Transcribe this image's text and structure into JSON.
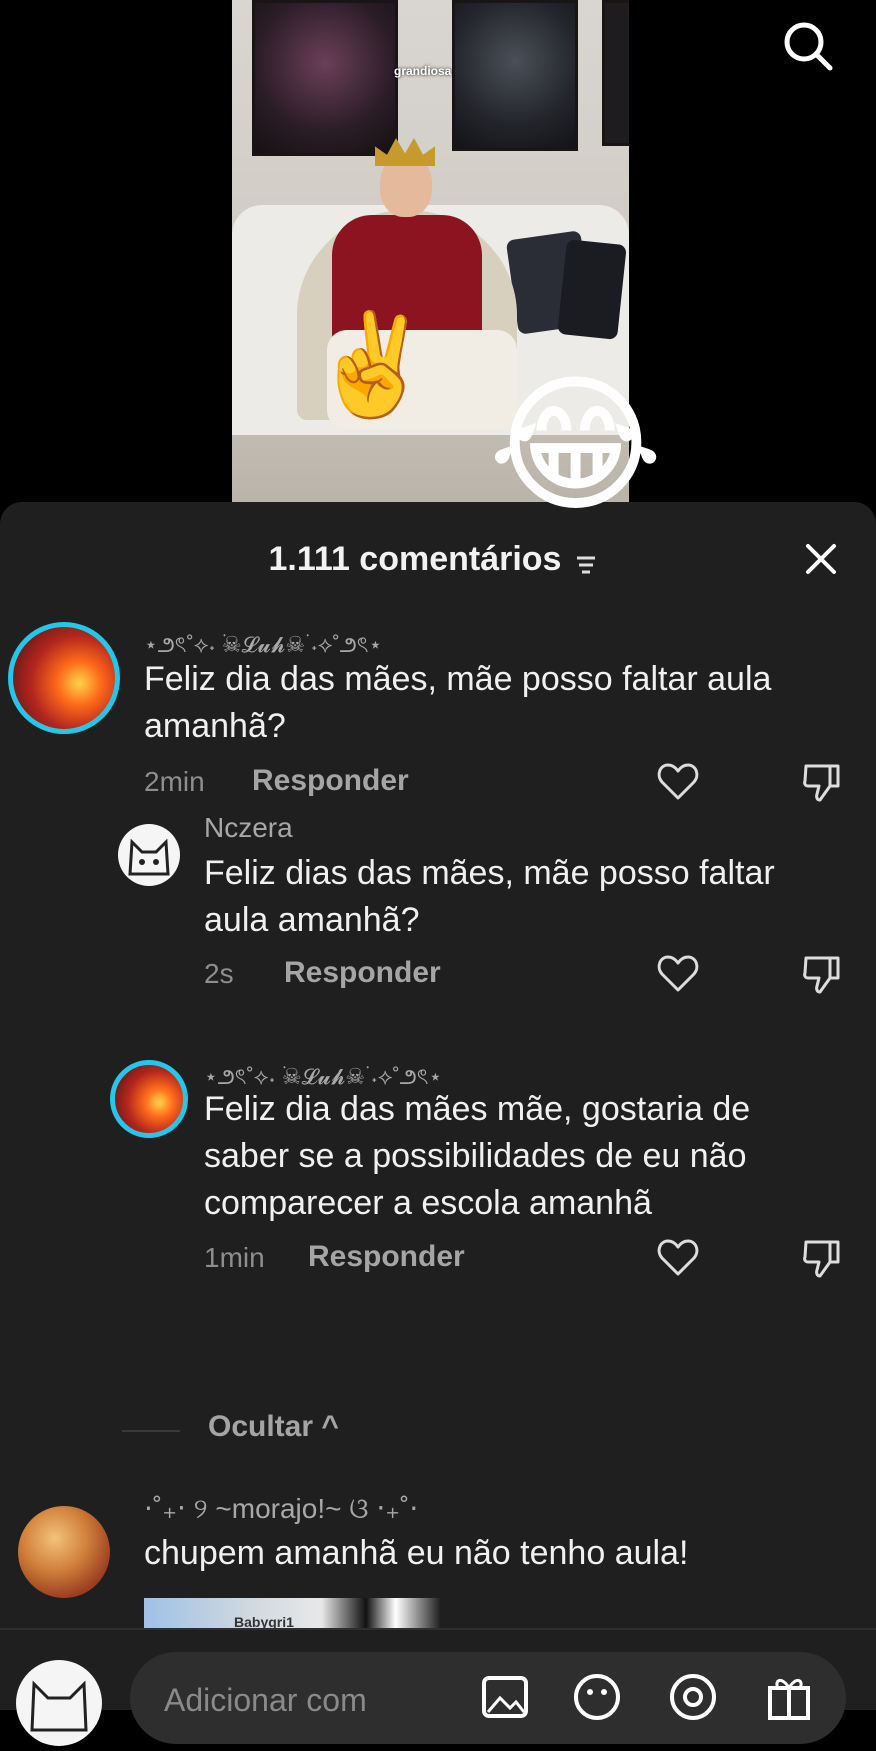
{
  "video": {
    "caption": "grandiosa",
    "emoji_peace": "✌️",
    "emoji_laugh": "😂"
  },
  "header": {
    "comments_count": "1.111 comentários"
  },
  "comments": [
    {
      "username": "⋆౨ৎ˚⟡˖ ࣪☠︎𝓛𝓾𝓱☠︎ ࣪˖⟡˚౨ৎ⋆",
      "text": "Feliz dia das mães, mãe posso faltar aula amanhã?",
      "time": "2min",
      "reply_label": "Responder"
    }
  ],
  "replies": [
    {
      "username": "Nczera",
      "text": "Feliz dias das mães, mãe posso faltar aula amanhã?",
      "time": "2s",
      "reply_label": "Responder"
    },
    {
      "username": "⋆౨ৎ˚⟡˖ ࣪☠︎𝓛𝓾𝓱☠︎ ࣪˖⟡˚౨ৎ⋆",
      "text": "Feliz dia das mães mãe, gostaria de saber se a possibilidades de eu não comparecer a escola amanhã",
      "time": "1min",
      "reply_label": "Responder"
    }
  ],
  "hide_replies": "Ocultar ^",
  "second_comment": {
    "username": "⋅˚₊‧ ୨ ~morajo!~ ଓ ‧₊˚⋅",
    "text": "chupem amanhã eu não tenho aula!",
    "thumb_label": "Babygri1"
  },
  "composer": {
    "placeholder": "Adicionar com"
  },
  "icons": {
    "search": "search-icon",
    "close": "close-icon",
    "like": "heart-icon",
    "dislike": "thumbs-down-icon",
    "image": "image-icon",
    "emoji": "emoji-icon",
    "mention": "at-mention-icon",
    "gift": "gift-icon"
  },
  "colors": {
    "sheet_bg": "#1f1f1f",
    "avatar_ring": "#25c6e8"
  }
}
